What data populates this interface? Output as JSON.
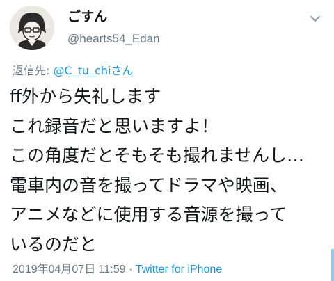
{
  "user": {
    "display_name": "ごすん",
    "handle": "@hearts54_Edan",
    "avatar": "avatar-illustration-icon"
  },
  "reply": {
    "prefix": "返信先: ",
    "mention": "@C_tu_chiさん"
  },
  "tweet": {
    "lines": [
      "ff外から失礼します",
      "これ録音だと思いますよ！",
      "この角度だとそもそも撮れませんし…",
      "電車内の音を撮ってドラマや映画、",
      "アニメなどに使用する音源を撮って",
      "いるのだと"
    ]
  },
  "meta": {
    "timestamp": "2019年04月07日 11:59",
    "separator": " · ",
    "source": "Twitter for iPhone"
  },
  "icons": {
    "menu": "chevron-down-icon"
  },
  "colors": {
    "text": "#14171a",
    "secondary": "#657786",
    "link": "#1b95e0"
  }
}
